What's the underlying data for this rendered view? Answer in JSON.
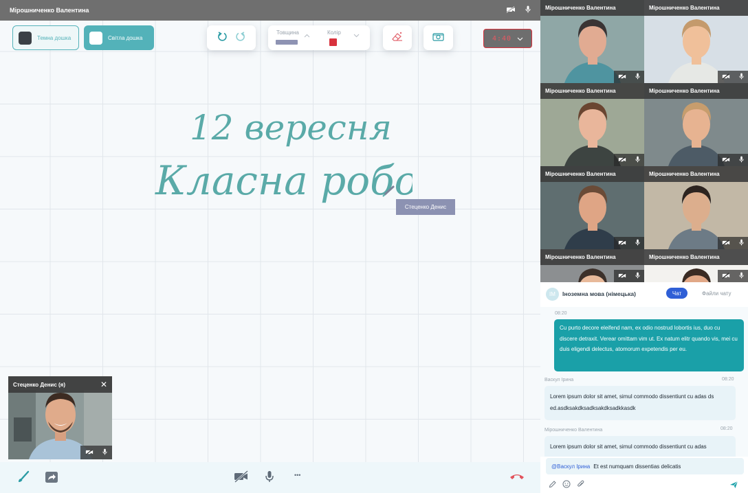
{
  "board": {
    "presenter_name": "Мірошниченко Валентина",
    "dark_board_label": "Темна дошка",
    "light_board_label": "Світла дошка",
    "thickness_label": "Товщина",
    "color_label": "Колір",
    "pen_color": "#d8323d",
    "timer": "4:40",
    "handwriting_line1": "12 вересня",
    "handwriting_line2": "Класна робота",
    "cursor_user": "Стеценко Денис",
    "self_preview_name": "Стеценко Денис (я)",
    "self_preview_close": "✕"
  },
  "bottom_bar": {
    "icons": [
      "brush-icon",
      "share-icon",
      "camera-off-icon",
      "mic-icon",
      "more-icon",
      "hangup-icon"
    ],
    "more_glyph": "•••"
  },
  "participants": [
    {
      "name": "Мірошниченко Валентина"
    },
    {
      "name": "Мірошниченко Валентина"
    },
    {
      "name": "Мірошниченко Валентина"
    },
    {
      "name": "Мірошниченко Валентина"
    },
    {
      "name": "Мірошниченко Валентина"
    },
    {
      "name": "Мірошниченко Валентина"
    },
    {
      "name": "Мірошниченко Валентина"
    },
    {
      "name": "Мірошниченко Валентина"
    }
  ],
  "chat": {
    "avatar_initials": "ІМ",
    "title": "Іноземна мова (німецька)",
    "tab_chat": "Чат",
    "tab_files": "Файли чату",
    "messages": [
      {
        "time": "08:20",
        "author": "",
        "text": "Cu purto decore eleifend nam, ex odio nostrud lobortis ius, duo cu discere detraxit. Verear omittam vim ut. Ex natum elitr quando vis, mei cu duis eligendi delectus, atomorum expetendis per eu."
      },
      {
        "time": "08:20",
        "author": "Васкул Ірина",
        "text": "Lorem ipsum dolor sit amet, simul commodo dissentiunt cu adas ds ed.asdksakdksadksakdksadkkasdk"
      },
      {
        "time": "08:20",
        "author": "Мірошниченко Валентина",
        "text": "Lorem ipsum dolor sit amet, simul commodo dissentiunt cu adas"
      }
    ],
    "input_mention": "@Васкул Ірина",
    "input_text": "Et est numquam dissentias delicatis"
  },
  "colors": {
    "accent": "#53b2b9",
    "chat_bubble": "#1aa0a8",
    "tab_active": "#2f5fd6",
    "handwriting": "#5aaaa8",
    "hangup": "#e2545d"
  }
}
